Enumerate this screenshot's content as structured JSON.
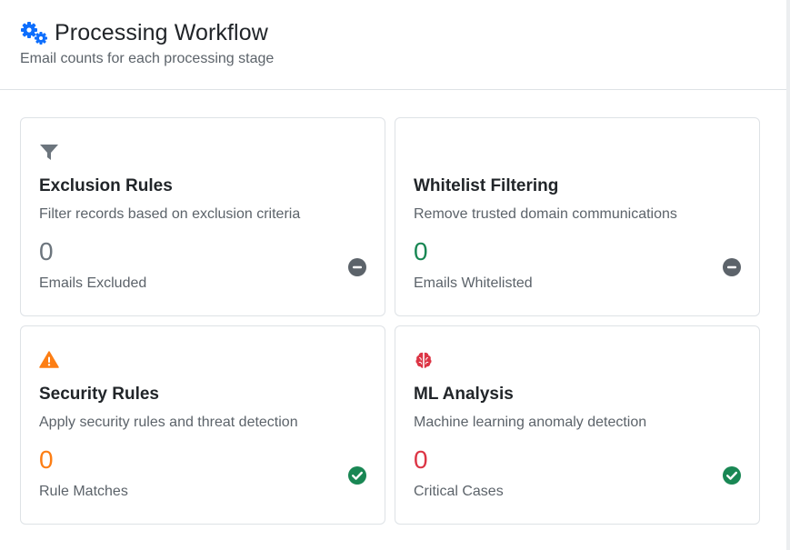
{
  "header": {
    "title": "Processing Workflow",
    "subtitle": "Email counts for each processing stage",
    "icon": "gears-icon",
    "icon_color": "#0d6efd"
  },
  "cards": [
    {
      "title": "Exclusion Rules",
      "description": "Filter records based on exclusion criteria",
      "count": "0",
      "label": "Emails Excluded",
      "icon": "filter-icon",
      "icon_color": "#6c757d",
      "count_color": "#6c757d",
      "status": "minus-circle-icon",
      "status_color": "#5c636a"
    },
    {
      "title": "Whitelist Filtering",
      "description": "Remove trusted domain communications",
      "count": "0",
      "label": "Emails Whitelisted",
      "icon": "",
      "count_color": "#198754",
      "status": "minus-circle-icon",
      "status_color": "#5c636a"
    },
    {
      "title": "Security Rules",
      "description": "Apply security rules and threat detection",
      "count": "0",
      "label": "Rule Matches",
      "icon": "warning-triangle-icon",
      "icon_color": "#fd7e14",
      "count_color": "#fd7e14",
      "status": "check-circle-icon",
      "status_color": "#198754"
    },
    {
      "title": "ML Analysis",
      "description": "Machine learning anomaly detection",
      "count": "0",
      "label": "Critical Cases",
      "icon": "brain-icon",
      "icon_color": "#dc3545",
      "count_color": "#dc3545",
      "status": "check-circle-icon",
      "status_color": "#198754"
    }
  ]
}
